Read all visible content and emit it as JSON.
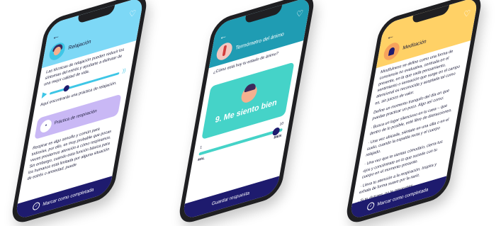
{
  "phones": [
    {
      "header_color": "#7dd8f6",
      "title": "Relajación",
      "intro": "Las técnicas de relajación pueden reducir los síntomas del estrés y ayudarte a disfrutar de una mejor calidad de vida.",
      "audio_caption": "Aquí encontrarás una práctica de relajación.",
      "audio_progress": 0.2,
      "card_title": "Práctica de respiración",
      "card_body": "Respirar es algo sencillo y común para todos/as, por ello, es muy probable que pocas veces prestemos atención a cómo respiramos. Sin embargo, cuando esta función básica para los humanos está limitada por alguna situación de estrés o ansiedad, puede",
      "button": "Marcar como completada",
      "icons": {
        "back": "back-arrow-icon",
        "heart": "heart-icon",
        "play": "play-icon",
        "volume": "volume-icon"
      }
    },
    {
      "header_color": "#1f9cb3",
      "title": "Termómetro del ánimo",
      "question": "¿Cómo está hoy tu estado de ánimo?",
      "mood_label": "9. Me siento bien",
      "slider": {
        "min": "1",
        "max": "10",
        "value": 9,
        "min_label": "MAL",
        "max_label": "BIEN"
      },
      "button": "Guardar respuesta"
    },
    {
      "header_color": "#ffd166",
      "title": "Meditación",
      "paragraphs": [
        "Mindfulness se define como una forma de conciencia no evaluativa, centrada en el presente, en la que cada pensamiento, sentimiento o sensación que surge en el campo atencional es reconocida y aceptada tal como es, sin juicios de valor.",
        "Define un momento tranquilo del día en que puedas practicar un poco. Algo así como:",
        "· Busca un lugar silencioso en tu casa – que dentro de lo posible, esté libre de distracciones.",
        "· Una vez ubicada, siéntate en una silla o en el suelo, cuando la espalda recta y el cuerpo relajado.",
        "· Una vez que te sientas cómoda/o, cierra tus ojos y concéntrate en lo que sucede con tu cuerpo en el momento presente.",
        "· Lleva tu atención a la respiración. Inspira y exhala de forma suave por la nariz.",
        "· Si te distraes, no te preocupes,"
      ],
      "button": "Marcar como completada"
    }
  ]
}
